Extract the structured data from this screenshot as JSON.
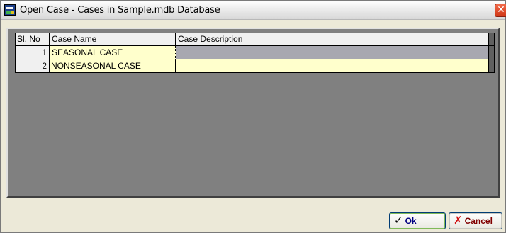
{
  "window": {
    "title": "Open Case - Cases in Sample.mdb Database",
    "app_icon": "database-app-icon",
    "close_glyph": "✕"
  },
  "grid": {
    "columns": [
      "Sl. No",
      "Case Name",
      "Case Description"
    ],
    "rows": [
      {
        "no": "1",
        "name": "SEASONAL CASE",
        "description": "",
        "selected": true
      },
      {
        "no": "2",
        "name": "NONSEASONAL CASE",
        "description": "",
        "selected": false
      }
    ]
  },
  "buttons": {
    "ok": {
      "label": "Ok",
      "icon": "checkmark-icon",
      "glyph": "✓"
    },
    "cancel": {
      "label": "Cancel",
      "icon": "cross-icon",
      "glyph": "✗"
    }
  },
  "colors": {
    "cell_background": "#ffffcc",
    "selected_row": "#a8a8b0",
    "grid_background": "#808080",
    "window_background": "#ece9d8"
  }
}
